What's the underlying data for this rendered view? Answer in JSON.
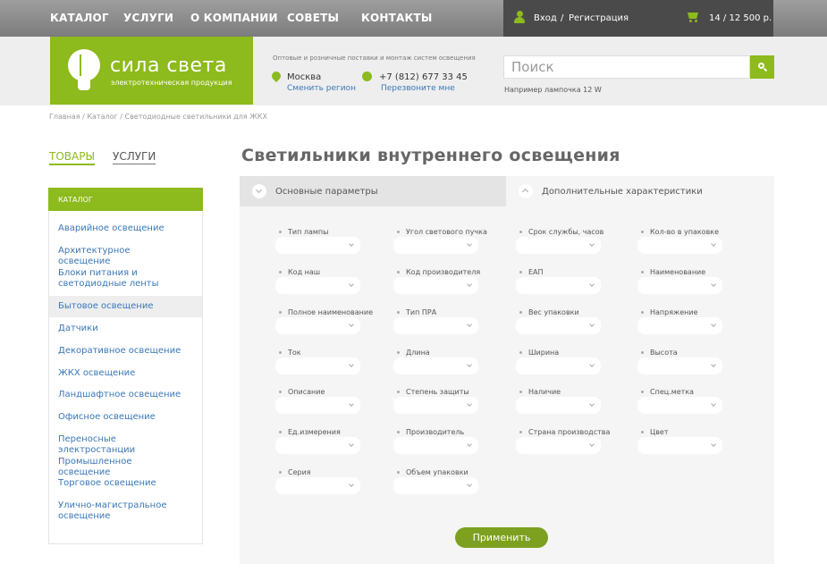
{
  "nav": [
    "КАТАЛОГ",
    "УСЛУГИ",
    "О КОМПАНИИ",
    "СОВЕТЫ",
    "КОНТАКТЫ"
  ],
  "user": {
    "login": "Вход",
    "separator": "/",
    "register": "Регистрация"
  },
  "cart": {
    "summary": "14  /  12 500 р."
  },
  "logo": {
    "name": "сила света",
    "subtitle": "электротехническая продукция"
  },
  "header": {
    "tagline": "Оптовые и розничные поставки и монтаж систем освещения",
    "city": "Москва",
    "change_region": "Сменить регион",
    "phone": "+7 (812) 677 33 45",
    "callback": "Перезвоните мне"
  },
  "search": {
    "placeholder": "Поиск",
    "hint": "Например лампочка 12 W"
  },
  "breadcrumb": [
    "Главная",
    "Каталог",
    "Светодиодные светильники для ЖКХ"
  ],
  "side_tabs": {
    "goods": "ТОВАРЫ",
    "services": "УСЛУГИ"
  },
  "sidebar": {
    "heading": "КАТАЛОГ",
    "items": [
      "Аварийное освещение",
      "Архитектурное освещение",
      "Блоки питания и светодиодные ленты",
      "Бытовое освещение",
      "Датчики",
      "Декоративное освещение",
      "ЖКХ освещение",
      "Ландшафтное освещение",
      "Офисное освещение",
      "Переносные электростанции",
      "Промышленное освещение",
      "Торговое освещение",
      "Улично-магистральное освещение"
    ],
    "active_index": 3
  },
  "page_title": "Светильники внутреннего освещения",
  "filter": {
    "tab_main": "Основные параметры",
    "tab_extra": "Дополнительные характеристики",
    "fields": [
      [
        "Тип лампы",
        "Угол светового пучка",
        "Срок службы, часов",
        "Кол-во в упаковке"
      ],
      [
        "Код наш",
        "Код производителя",
        "ЕАП",
        "Наименование"
      ],
      [
        "Полное наименование",
        "Тип ПРА",
        "Вес упаковки",
        "Напряжение"
      ],
      [
        "Ток",
        "Длина",
        "Ширина",
        "Высота"
      ],
      [
        "Описание",
        "Степень защиты",
        "Наличие",
        "Спец.метка"
      ],
      [
        "Ед.измерения",
        "Производитель",
        "Страна производства",
        "Цвет"
      ],
      [
        "Серия",
        "Объем упаковки"
      ]
    ],
    "apply": "Применить"
  },
  "colors": {
    "accent": "#8dba1c",
    "apply": "#7da020",
    "link": "#3a77b8"
  }
}
